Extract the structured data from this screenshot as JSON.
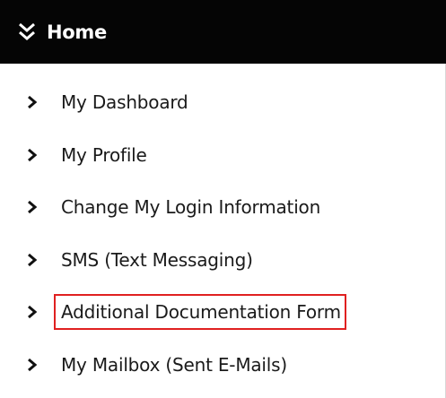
{
  "header": {
    "title": "Home",
    "icon": "double-chevron-down-icon"
  },
  "menu": {
    "items": [
      {
        "label": "My Dashboard"
      },
      {
        "label": "My Profile"
      },
      {
        "label": "Change My Login Information"
      },
      {
        "label": "SMS (Text Messaging)"
      },
      {
        "label": "Additional Documentation Form"
      },
      {
        "label": "My Mailbox (Sent E-Mails)"
      }
    ]
  },
  "colors": {
    "header_bg": "#050505",
    "header_text": "#ffffff",
    "item_text": "#1a1a1a",
    "highlight_border": "#e02020"
  }
}
